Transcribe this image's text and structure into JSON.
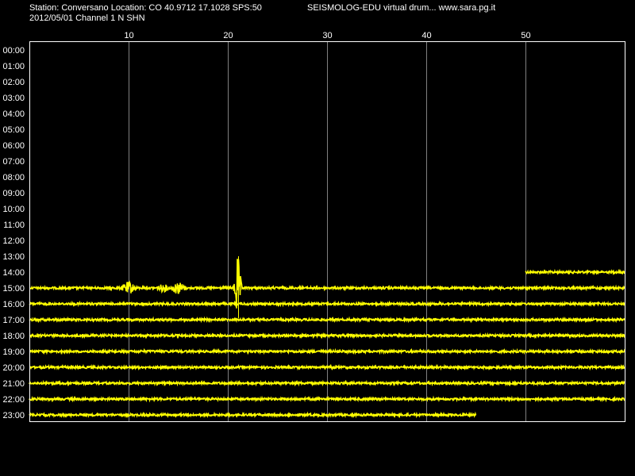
{
  "header": {
    "station_line": "Station: Conversano Location: CO 40.9712 17.1028 SPS:50",
    "program_line": "SEISMOLOG-EDU virtual drum... www.sara.pg.it",
    "date_line": "2012/05/01  Channel 1 N SHN"
  },
  "chart_data": {
    "type": "line",
    "xlim": [
      0,
      60
    ],
    "x_ticks": [
      "10",
      "20",
      "30",
      "40",
      "50"
    ],
    "x_tick_values": [
      10,
      20,
      30,
      40,
      50
    ],
    "y_labels": [
      "00:00",
      "01:00",
      "02:00",
      "03:00",
      "04:00",
      "05:00",
      "06:00",
      "07:00",
      "08:00",
      "09:00",
      "10:00",
      "11:00",
      "12:00",
      "13:00",
      "14:00",
      "15:00",
      "16:00",
      "17:00",
      "18:00",
      "19:00",
      "20:00",
      "21:00",
      "22:00",
      "23:00"
    ],
    "grid": true,
    "traces": [
      {
        "hour": "14:00",
        "start_min": 50,
        "end_min": 60
      },
      {
        "hour": "15:00",
        "start_min": 0,
        "end_min": 60
      },
      {
        "hour": "16:00",
        "start_min": 0,
        "end_min": 60
      },
      {
        "hour": "17:00",
        "start_min": 0,
        "end_min": 60
      },
      {
        "hour": "18:00",
        "start_min": 0,
        "end_min": 60
      },
      {
        "hour": "19:00",
        "start_min": 0,
        "end_min": 60
      },
      {
        "hour": "20:00",
        "start_min": 0,
        "end_min": 60
      },
      {
        "hour": "21:00",
        "start_min": 0,
        "end_min": 60
      },
      {
        "hour": "22:00",
        "start_min": 0,
        "end_min": 60
      },
      {
        "hour": "23:00",
        "start_min": 0,
        "end_min": 45
      }
    ],
    "events": [
      {
        "hour": "15:00",
        "minute": 10,
        "amplitude": "medium"
      },
      {
        "hour": "15:00",
        "minute": 13.5,
        "amplitude": "small"
      },
      {
        "hour": "15:00",
        "minute": 15,
        "amplitude": "medium"
      },
      {
        "hour": "15:00",
        "minute": 21,
        "amplitude": "large"
      }
    ],
    "colors": {
      "background": "#000000",
      "trace": "#ffff00",
      "grid": "#808080",
      "text": "#ffffff"
    }
  }
}
